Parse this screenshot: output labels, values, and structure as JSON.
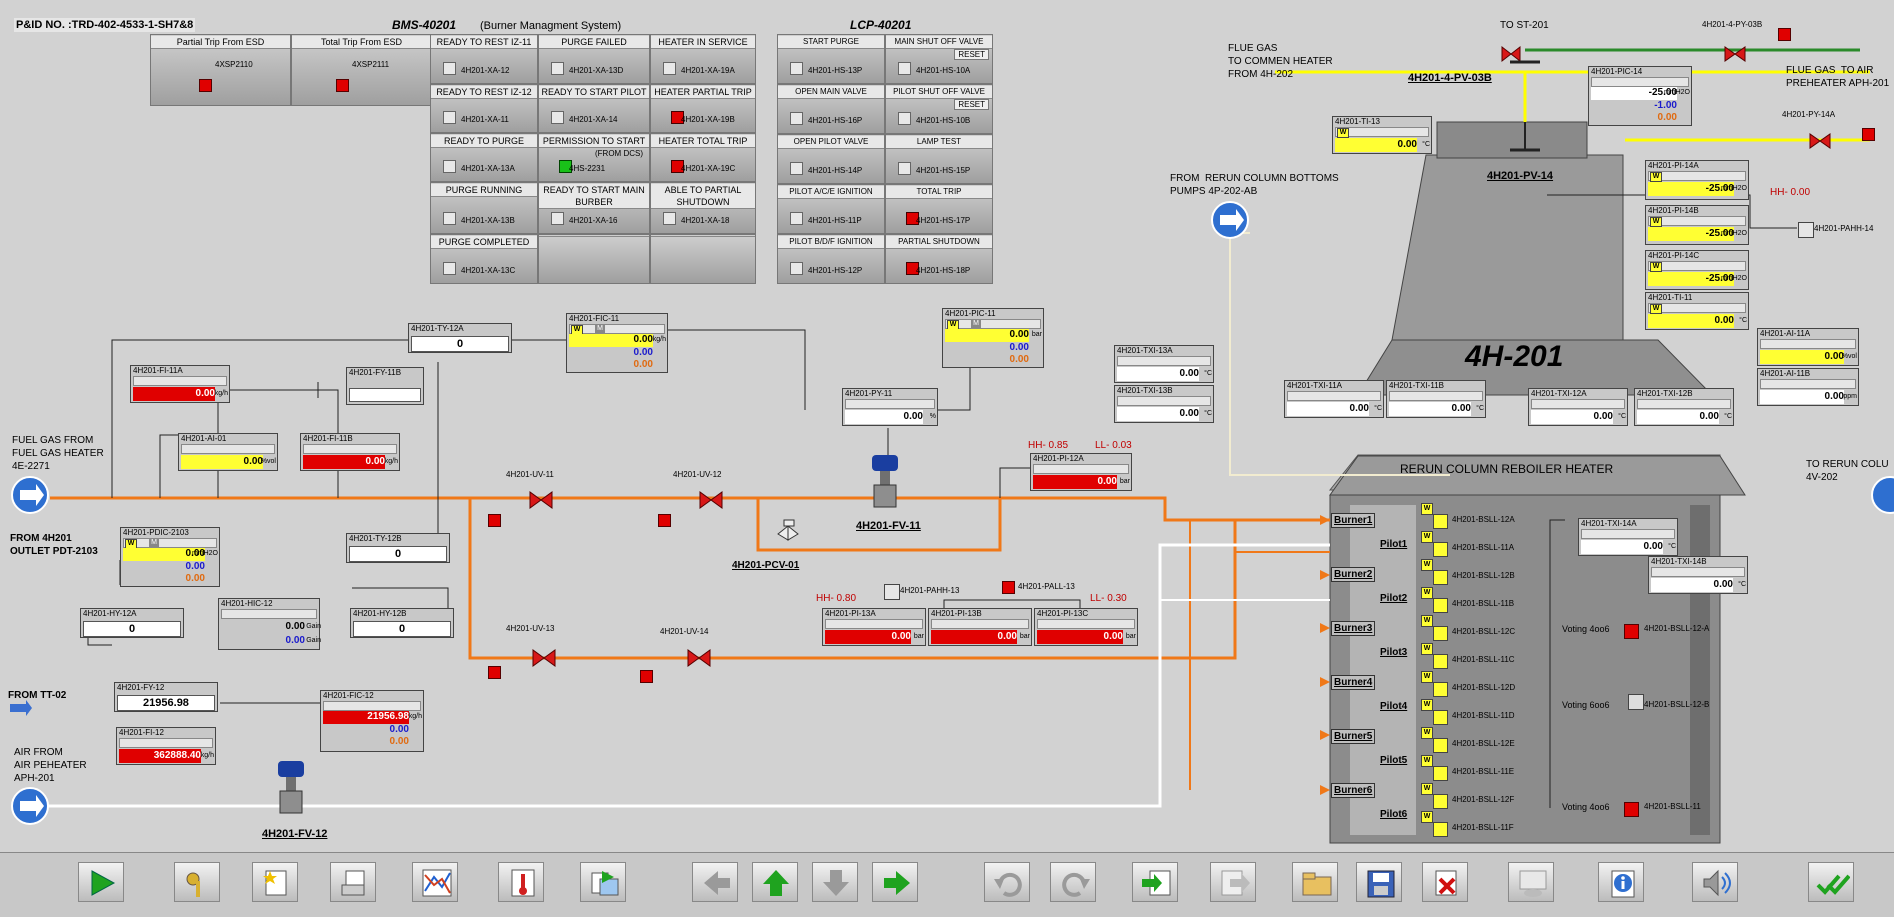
{
  "header": {
    "pid": "P&ID NO. :TRD-402-4533-1-SH7&8",
    "bms": "BMS-40201",
    "bms_desc": "(Burner Managment System)",
    "lcp": "LCP-40201"
  },
  "esd": {
    "partial_label": "Partial Trip From ESD",
    "partial_tag": "4XSP2110",
    "total_label": "Total Trip From ESD",
    "total_tag": "4XSP2111"
  },
  "bms_cells": [
    {
      "title": "READY TO REST IZ-11",
      "tag": "4H201-XA-12"
    },
    {
      "title": "PURGE FAILED",
      "tag": "4H201-XA-13D"
    },
    {
      "title": "HEATER IN SERVICE",
      "tag": "4H201-XA-19A"
    },
    {
      "title": "READY TO REST IZ-12",
      "tag": "4H201-XA-11"
    },
    {
      "title": "READY TO START PILOT",
      "tag": "4H201-XA-14"
    },
    {
      "title": "HEATER PARTIAL TRIP",
      "tag": "4H201-XA-19B"
    },
    {
      "title": "READY TO PURGE",
      "tag": "4H201-XA-13A"
    },
    {
      "title": "PERMISSION TO START",
      "tag": "4HS-2231",
      "sub": "(FROM DCS)"
    },
    {
      "title": "HEATER TOTAL TRIP",
      "tag": "4H201-XA-19C"
    },
    {
      "title": "PURGE RUNNING",
      "tag": "4H201-XA-13B"
    },
    {
      "title": "READY TO START MAIN BURBER",
      "tag": "4H201-XA-16"
    },
    {
      "title": "ABLE TO PARTIAL SHUTDOWN",
      "tag": "4H201-XA-18"
    },
    {
      "title": "PURGE COMPLETED",
      "tag": "4H201-XA-13C"
    },
    {
      "title": "",
      "tag": ""
    },
    {
      "title": "",
      "tag": ""
    }
  ],
  "lcp_cells": [
    {
      "title": "START PURGE",
      "tag": "4H201-HS-13P"
    },
    {
      "title": "MAIN SHUT OFF VALVE",
      "tag": "4H201-HS-10A",
      "reset": "RESET"
    },
    {
      "title": "OPEN MAIN VALVE",
      "tag": "4H201-HS-16P"
    },
    {
      "title": "PILOT SHUT OFF VALVE",
      "tag": "4H201-HS-10B",
      "reset": "RESET"
    },
    {
      "title": "OPEN PILOT VALVE",
      "tag": "4H201-HS-14P"
    },
    {
      "title": "LAMP TEST",
      "tag": "4H201-HS-15P"
    },
    {
      "title": "PILOT A/C/E IGNITION",
      "tag": "4H201-HS-11P"
    },
    {
      "title": "TOTAL TRIP",
      "tag": "4H201-HS-17P"
    },
    {
      "title": "PILOT B/D/F IGNITION",
      "tag": "4H201-HS-12P"
    },
    {
      "title": "PARTIAL SHUTDOWN",
      "tag": "4H201-HS-18P"
    }
  ],
  "labels": {
    "fuel_gas": "FUEL GAS FROM\nFUEL GAS HEATER\n4E-2271",
    "from_4h201": "FROM 4H201\nOUTLET PDT-2103",
    "from_tt02": "FROM TT-02",
    "air_from": "AIR FROM\nAIR PEHEATER\nAPH-201",
    "to_st201": "TO ST-201",
    "flue_gas_common": "FLUE GAS\nTO COMMEN HEATER\nFROM 4H-202",
    "flue_gas_aph": "FLUE GAS  TO AIR\nPREHEATER APH-201",
    "from_rerun": "FROM  RERUN COLUMN BOTTOMS\nPUMPS 4P-202-AB",
    "to_rerun": "TO RERUN COLU\n4V-202",
    "heater": "4H-201",
    "reboiler": "RERUN COLUMN REBOILER HEATER",
    "pv03b": "4H201-4-PV-03B",
    "pv14": "4H201-PV-14",
    "fv11": "4H201-FV-11",
    "fv12": "4H201-FV-12",
    "pcv01": "4H201-PCV-01",
    "pahh14": "4H201-PAHH-14",
    "pahh13": "4H201-PAHH-13",
    "pall13": "4H201-PALL-13",
    "py03b": "4H201-4-PY-03B",
    "py14a": "4H201-PY-14A",
    "uv11": "4H201-UV-11",
    "uv12": "4H201-UV-12",
    "uv13": "4H201-UV-13",
    "uv14": "4H201-UV-14"
  },
  "alarm_limits": {
    "hh_12a": "HH-  0.85",
    "ll_12a": "LL-  0.03",
    "hh_13": "HH-  0.80",
    "ll_13": "LL-  0.30",
    "hh_14": "HH-  0.00"
  },
  "faceplates": {
    "fi11a": {
      "tag": "4H201-FI-11A",
      "value": "0.00",
      "unit": "kg/h"
    },
    "ai01": {
      "tag": "4H201-AI-01",
      "value": "0.00",
      "unit": "%vol"
    },
    "fi11b": {
      "tag": "4H201-FI-11B",
      "value": "0.00",
      "unit": "kg/h"
    },
    "fy11b": {
      "tag": "4H201-FY-11B",
      "value": ""
    },
    "ty12a": {
      "tag": "4H201-TY-12A",
      "value": "0"
    },
    "fic11": {
      "tag": "4H201-FIC-11",
      "pv": "0.00",
      "sp": "0.00",
      "out": "0.00",
      "unit": "kg/h"
    },
    "pic11": {
      "tag": "4H201-PIC-11",
      "pv": "0.00",
      "sp": "0.00",
      "out": "0.00",
      "unit": "bar"
    },
    "py11": {
      "tag": "4H201-PY-11",
      "value": "0.00",
      "unit": "%"
    },
    "pdic2103": {
      "tag": "4H201-PDIC-2103",
      "pv": "0.00",
      "sp": "0.00",
      "out": "0.00",
      "unit": "mmH2O"
    },
    "ty12b": {
      "tag": "4H201-TY-12B",
      "value": "0"
    },
    "hic12": {
      "tag": "4H201-HIC-12",
      "v1": "0.00",
      "v2": "0.00",
      "unit": "Gain"
    },
    "hy12a": {
      "tag": "4H201-HY-12A",
      "value": "0"
    },
    "hy12b": {
      "tag": "4H201-HY-12B",
      "value": "0"
    },
    "fy12": {
      "tag": "4H201-FY-12",
      "value": "21956.98"
    },
    "fi12": {
      "tag": "4H201-FI-12",
      "value": "362888.40",
      "unit": "kg/h"
    },
    "fic12": {
      "tag": "4H201-FIC-12",
      "pv": "21956.98",
      "sp": "0.00",
      "out": "0.00",
      "unit": "kg/h"
    },
    "pi12a": {
      "tag": "4H201-PI-12A",
      "value": "0.00",
      "unit": "bar"
    },
    "pi13a": {
      "tag": "4H201-PI-13A",
      "value": "0.00",
      "unit": "bar"
    },
    "pi13b": {
      "tag": "4H201-PI-13B",
      "value": "0.00",
      "unit": "bar"
    },
    "pi13c": {
      "tag": "4H201-PI-13C",
      "value": "0.00",
      "unit": "bar"
    },
    "pic14": {
      "tag": "4H201-PIC-14",
      "pv": "-25.00",
      "sp": "-1.00",
      "out": "0.00",
      "unit": "mmH2O"
    },
    "ti13": {
      "tag": "4H201-TI-13",
      "value": "0.00",
      "unit": "°C"
    },
    "pi14a": {
      "tag": "4H201-PI-14A",
      "value": "-25.00",
      "unit": "mmH2O"
    },
    "pi14b": {
      "tag": "4H201-PI-14B",
      "value": "-25.00",
      "unit": "mmH2O"
    },
    "pi14c": {
      "tag": "4H201-PI-14C",
      "value": "-25.00",
      "unit": "mmH2O"
    },
    "ti11": {
      "tag": "4H201-TI-11",
      "value": "0.00",
      "unit": "°C"
    },
    "ai11a": {
      "tag": "4H201-AI-11A",
      "value": "0.00",
      "unit": "%vol"
    },
    "ai11b": {
      "tag": "4H201-AI-11B",
      "value": "0.00",
      "unit": "ppm"
    },
    "txi13a": {
      "tag": "4H201-TXI-13A",
      "value": "0.00",
      "unit": "°C"
    },
    "txi13b": {
      "tag": "4H201-TXI-13B",
      "value": "0.00",
      "unit": "°C"
    },
    "txi11a": {
      "tag": "4H201-TXI-11A",
      "value": "0.00",
      "unit": "°C"
    },
    "txi11b": {
      "tag": "4H201-TXI-11B",
      "value": "0.00",
      "unit": "°C"
    },
    "txi12a": {
      "tag": "4H201-TXI-12A",
      "value": "0.00",
      "unit": "°C"
    },
    "txi12b": {
      "tag": "4H201-TXI-12B",
      "value": "0.00",
      "unit": "°C"
    },
    "txi14a": {
      "tag": "4H201-TXI-14A",
      "value": "0.00",
      "unit": "°C"
    },
    "txi14b": {
      "tag": "4H201-TXI-14B",
      "value": "0.00",
      "unit": "°C"
    }
  },
  "burners": [
    "Burner1",
    "Burner2",
    "Burner3",
    "Burner4",
    "Burner5",
    "Burner6"
  ],
  "pilots": [
    "Pilot1",
    "Pilot2",
    "Pilot3",
    "Pilot4",
    "Pilot5",
    "Pilot6"
  ],
  "bsll": [
    "4H201-BSLL-12A",
    "4H201-BSLL-11A",
    "4H201-BSLL-12B",
    "4H201-BSLL-11B",
    "4H201-BSLL-12C",
    "4H201-BSLL-11C",
    "4H201-BSLL-12D",
    "4H201-BSLL-11D",
    "4H201-BSLL-12E",
    "4H201-BSLL-11E",
    "4H201-BSLL-12F",
    "4H201-BSLL-11F"
  ],
  "voting": [
    {
      "label": "Voting 4oo6",
      "tag": "4H201-BSLL-12-A"
    },
    {
      "label": "Voting 6oo6",
      "tag": "4H201-BSLL-12-B"
    },
    {
      "label": "Voting 4oo6",
      "tag": "4H201-BSLL-11"
    }
  ],
  "w": "W",
  "m": "M",
  "colors": {
    "fuel_line": "#f07818",
    "flue": "#ffff00",
    "air": "#ffffff",
    "alarm": "#e00000"
  },
  "toolbar": [
    "play-icon",
    "keys-icon",
    "star-doc-icon",
    "report-icon",
    "trend-icon",
    "thermometer-icon",
    "export-icon",
    "arrow-left-icon",
    "arrow-up-icon",
    "arrow-down-icon",
    "arrow-right-icon",
    "undo-icon",
    "redo-icon",
    "login-icon",
    "logout-icon",
    "folder-icon",
    "save-icon",
    "delete-icon",
    "view-icon",
    "info-icon",
    "sound-icon",
    "acknowledge-icon"
  ]
}
